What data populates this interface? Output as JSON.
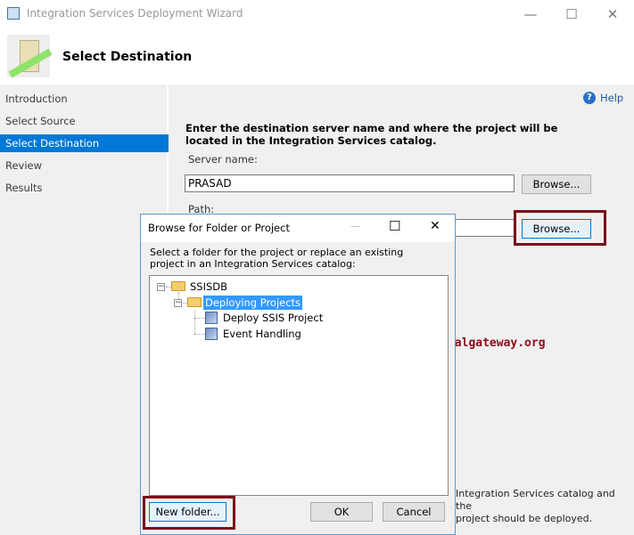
{
  "window": {
    "title": "Integration Services Deployment Wizard",
    "minimize": "—",
    "maximize": "☐",
    "close": "✕"
  },
  "header": {
    "title": "Select Destination"
  },
  "nav": {
    "items": [
      {
        "label": "Introduction"
      },
      {
        "label": "Select Source"
      },
      {
        "label": "Select Destination"
      },
      {
        "label": "Review"
      },
      {
        "label": "Results"
      }
    ]
  },
  "main": {
    "help": "Help",
    "instructions": "Enter the destination server name and where the project will be located in the Integration Services catalog.",
    "server_label": "Server name:",
    "server_value": "PRASAD",
    "browse1": "Browse...",
    "path_label": "Path:",
    "path_value": "",
    "browse2": "Browse...",
    "footer_text_1": "Integration Services catalog and the",
    "footer_text_2": "project should be deployed."
  },
  "watermark": "©tutorialgateway.org",
  "dialog": {
    "title": "Browse for Folder or Project",
    "minimize": "—",
    "maximize": "☐",
    "close": "✕",
    "prompt": "Select a folder for the project or replace an existing project in an Integration Services catalog:",
    "tree": {
      "root": "SSISDB",
      "folder": "Deploying Projects",
      "projects": [
        "Deploy SSIS Project",
        "Event Handling"
      ]
    },
    "new_folder": "New folder...",
    "ok": "OK",
    "cancel": "Cancel"
  }
}
